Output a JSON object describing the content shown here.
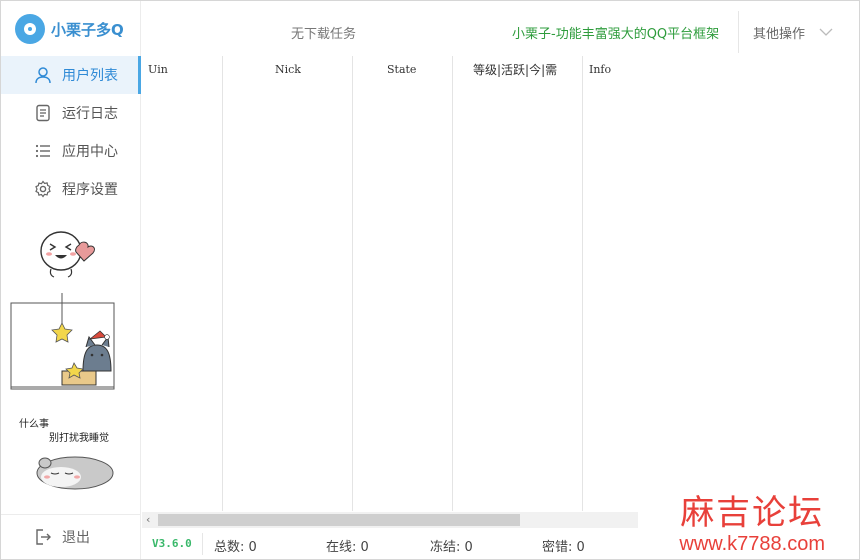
{
  "app": {
    "name": "小栗子多Q"
  },
  "sidebar": {
    "items": [
      {
        "label": "用户列表",
        "icon": "user-icon",
        "active": true
      },
      {
        "label": "运行日志",
        "icon": "document-icon",
        "active": false
      },
      {
        "label": "应用中心",
        "icon": "list-icon",
        "active": false
      },
      {
        "label": "程序设置",
        "icon": "gear-icon",
        "active": false
      }
    ],
    "sticker_text": [
      "什么事",
      "别打扰我睡觉"
    ],
    "logout_label": "退出"
  },
  "header": {
    "task_status": "无下载任务",
    "slogan": "小栗子-功能丰富强大的QQ平台框架",
    "more_ops": "其他操作"
  },
  "table": {
    "columns": [
      "Uin",
      "Nick",
      "State",
      "等级|活跃|今|需",
      "Info"
    ],
    "rows": []
  },
  "statusbar": {
    "version": "V3.6.0",
    "total": "总数: 0",
    "online": "在线: 0",
    "frozen": "冻结: 0",
    "wrong_pwd": "密错: 0"
  },
  "watermark": {
    "title": "麻吉论坛",
    "url": "www.k7788.com"
  },
  "colors": {
    "accent": "#4aa7e4",
    "slogan": "#2e9c3c",
    "version": "#39b86a",
    "watermark": "#e8403a"
  }
}
